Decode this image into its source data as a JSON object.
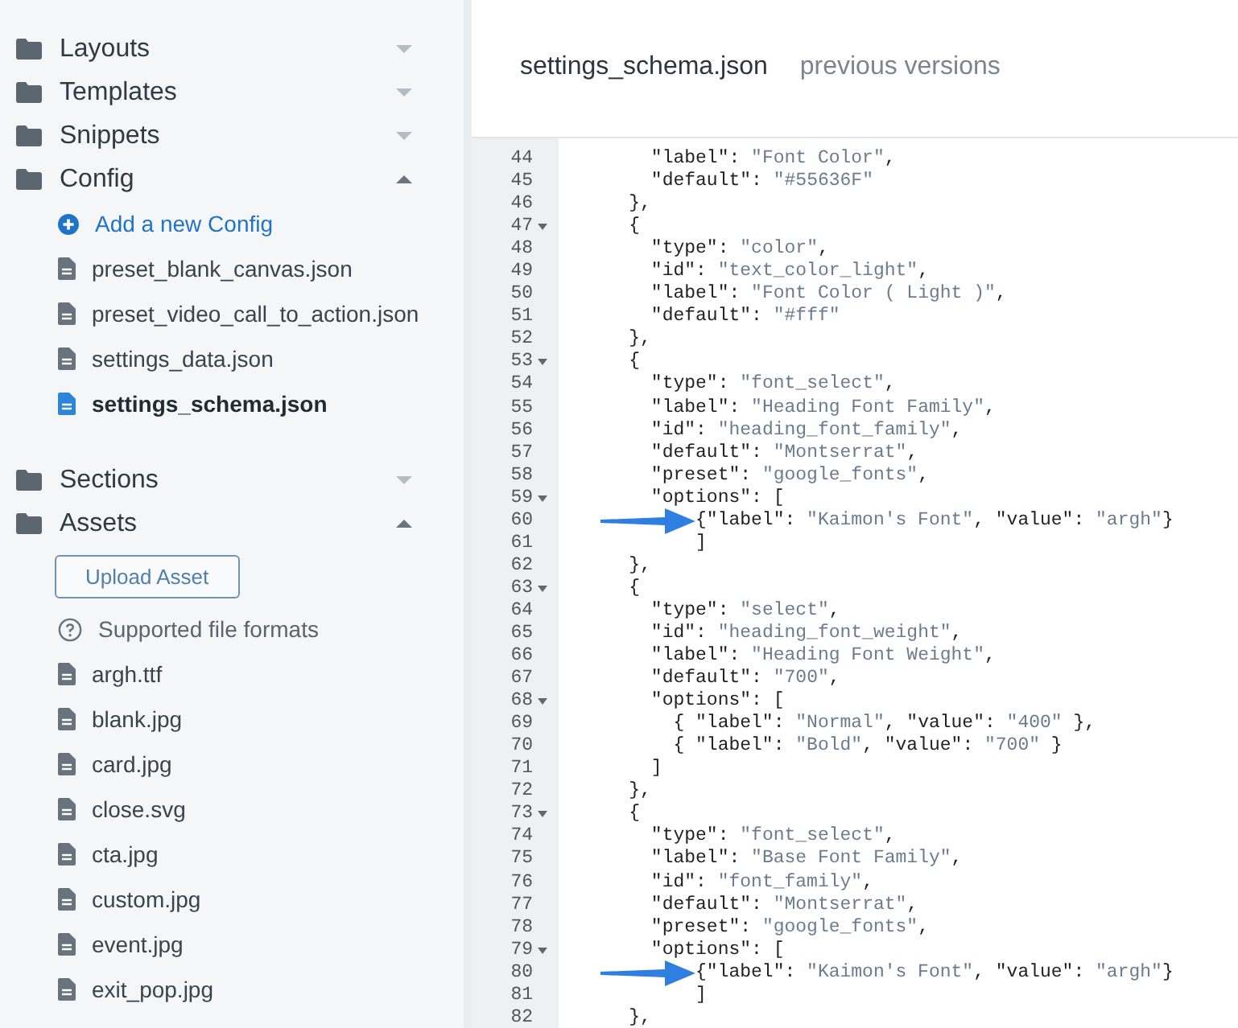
{
  "sidebar": {
    "folders": [
      {
        "label": "Layouts",
        "expanded": false
      },
      {
        "label": "Templates",
        "expanded": false
      },
      {
        "label": "Snippets",
        "expanded": false
      },
      {
        "label": "Config",
        "expanded": true,
        "children": [
          {
            "kind": "action",
            "label": "Add a new Config"
          },
          {
            "kind": "file",
            "label": "preset_blank_canvas.json",
            "selected": false
          },
          {
            "kind": "file",
            "label": "preset_video_call_to_action.json",
            "selected": false
          },
          {
            "kind": "file",
            "label": "settings_data.json",
            "selected": false
          },
          {
            "kind": "file",
            "label": "settings_schema.json",
            "selected": true
          }
        ]
      },
      {
        "label": "Sections",
        "expanded": false
      },
      {
        "label": "Assets",
        "expanded": true,
        "children": [
          {
            "kind": "button",
            "label": "Upload Asset"
          },
          {
            "kind": "help",
            "label": "Supported file formats"
          },
          {
            "kind": "file",
            "label": "argh.ttf",
            "selected": false
          },
          {
            "kind": "file",
            "label": "blank.jpg",
            "selected": false
          },
          {
            "kind": "file",
            "label": "card.jpg",
            "selected": false
          },
          {
            "kind": "file",
            "label": "close.svg",
            "selected": false
          },
          {
            "kind": "file",
            "label": "cta.jpg",
            "selected": false
          },
          {
            "kind": "file",
            "label": "custom.jpg",
            "selected": false
          },
          {
            "kind": "file",
            "label": "event.jpg",
            "selected": false
          },
          {
            "kind": "file",
            "label": "exit_pop.jpg",
            "selected": false
          }
        ]
      }
    ]
  },
  "editor": {
    "tabs": [
      {
        "label": "settings_schema.json",
        "selected": true
      },
      {
        "label": "previous versions",
        "selected": false
      }
    ],
    "lines": [
      {
        "number": "44",
        "fold": false,
        "text": "      \"label\": \"Font Color\","
      },
      {
        "number": "45",
        "fold": false,
        "text": "      \"default\": \"#55636F\""
      },
      {
        "number": "46",
        "fold": false,
        "text": "    },"
      },
      {
        "number": "47",
        "fold": true,
        "text": "    {"
      },
      {
        "number": "48",
        "fold": false,
        "text": "      \"type\": \"color\","
      },
      {
        "number": "49",
        "fold": false,
        "text": "      \"id\": \"text_color_light\","
      },
      {
        "number": "50",
        "fold": false,
        "text": "      \"label\": \"Font Color ( Light )\","
      },
      {
        "number": "51",
        "fold": false,
        "text": "      \"default\": \"#fff\""
      },
      {
        "number": "52",
        "fold": false,
        "text": "    },"
      },
      {
        "number": "53",
        "fold": true,
        "text": "    {"
      },
      {
        "number": "54",
        "fold": false,
        "text": "      \"type\": \"font_select\","
      },
      {
        "number": "55",
        "fold": false,
        "text": "      \"label\": \"Heading Font Family\","
      },
      {
        "number": "56",
        "fold": false,
        "text": "      \"id\": \"heading_font_family\","
      },
      {
        "number": "57",
        "fold": false,
        "text": "      \"default\": \"Montserrat\","
      },
      {
        "number": "58",
        "fold": false,
        "text": "      \"preset\": \"google_fonts\","
      },
      {
        "number": "59",
        "fold": true,
        "text": "      \"options\": ["
      },
      {
        "number": "60",
        "fold": false,
        "arrow": true,
        "text": "          {\"label\": \"Kaimon's Font\", \"value\": \"argh\"}"
      },
      {
        "number": "61",
        "fold": false,
        "text": "          ]"
      },
      {
        "number": "62",
        "fold": false,
        "text": "    },"
      },
      {
        "number": "63",
        "fold": true,
        "text": "    {"
      },
      {
        "number": "64",
        "fold": false,
        "text": "      \"type\": \"select\","
      },
      {
        "number": "65",
        "fold": false,
        "text": "      \"id\": \"heading_font_weight\","
      },
      {
        "number": "66",
        "fold": false,
        "text": "      \"label\": \"Heading Font Weight\","
      },
      {
        "number": "67",
        "fold": false,
        "text": "      \"default\": \"700\","
      },
      {
        "number": "68",
        "fold": true,
        "text": "      \"options\": ["
      },
      {
        "number": "69",
        "fold": false,
        "text": "        { \"label\": \"Normal\", \"value\": \"400\" },"
      },
      {
        "number": "70",
        "fold": false,
        "text": "        { \"label\": \"Bold\", \"value\": \"700\" }"
      },
      {
        "number": "71",
        "fold": false,
        "text": "      ]"
      },
      {
        "number": "72",
        "fold": false,
        "text": "    },"
      },
      {
        "number": "73",
        "fold": true,
        "text": "    {"
      },
      {
        "number": "74",
        "fold": false,
        "text": "      \"type\": \"font_select\","
      },
      {
        "number": "75",
        "fold": false,
        "text": "      \"label\": \"Base Font Family\","
      },
      {
        "number": "76",
        "fold": false,
        "text": "      \"id\": \"font_family\","
      },
      {
        "number": "77",
        "fold": false,
        "text": "      \"default\": \"Montserrat\","
      },
      {
        "number": "78",
        "fold": false,
        "text": "      \"preset\": \"google_fonts\","
      },
      {
        "number": "79",
        "fold": true,
        "text": "      \"options\": ["
      },
      {
        "number": "80",
        "fold": false,
        "arrow": true,
        "text": "          {\"label\": \"Kaimon's Font\", \"value\": \"argh\"}"
      },
      {
        "number": "81",
        "fold": false,
        "text": "          ]"
      },
      {
        "number": "82",
        "fold": false,
        "text": "    },"
      }
    ]
  }
}
